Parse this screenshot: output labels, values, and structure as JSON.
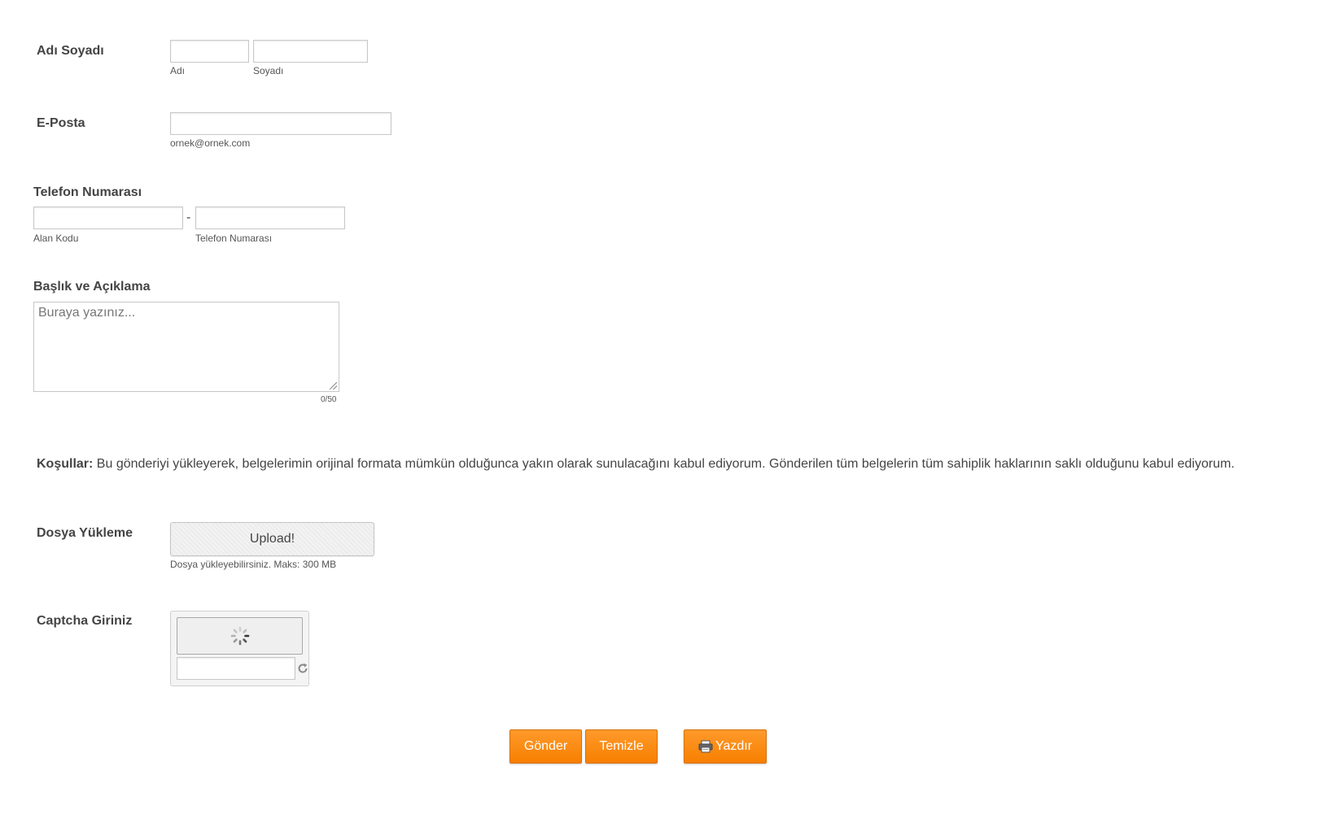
{
  "name_field": {
    "label": "Adı Soyadı",
    "first_sublabel": "Adı",
    "last_sublabel": "Soyadı",
    "first_value": "",
    "last_value": ""
  },
  "email_field": {
    "label": "E-Posta",
    "sublabel": "ornek@ornek.com",
    "value": ""
  },
  "phone_field": {
    "label": "Telefon Numarası",
    "area_sublabel": "Alan Kodu",
    "separator": "-",
    "number_sublabel": "Telefon Numarası",
    "area_value": "",
    "number_value": ""
  },
  "description_field": {
    "label": "Başlık ve Açıklama",
    "placeholder": "Buraya yazınız...",
    "char_count": "0/50"
  },
  "terms": {
    "bold": "Koşullar:",
    "text": "Bu gönderiyi yükleyerek, belgelerimin orijinal formata mümkün olduğunca yakın olarak sunulacağını kabul ediyorum. Gönderilen tüm belgelerin tüm sahiplik haklarının saklı olduğunu kabul ediyorum."
  },
  "upload_field": {
    "label": "Dosya Yükleme",
    "button_label": "Upload!",
    "sublabel": "Dosya yükleyebilirsiniz. Maks: 300 MB"
  },
  "captcha_field": {
    "label": "Captcha Giriniz",
    "value": "",
    "image_state_icon": "loading-spinner-icon",
    "refresh_icon": "refresh-icon"
  },
  "actions": {
    "submit_label": "Gönder",
    "clear_label": "Temizle",
    "print_label": "Yazdır",
    "print_icon": "printer-icon"
  },
  "colors": {
    "button_orange": "#f7890c",
    "label_text": "#444444",
    "field_border": "#c8c8c8"
  }
}
